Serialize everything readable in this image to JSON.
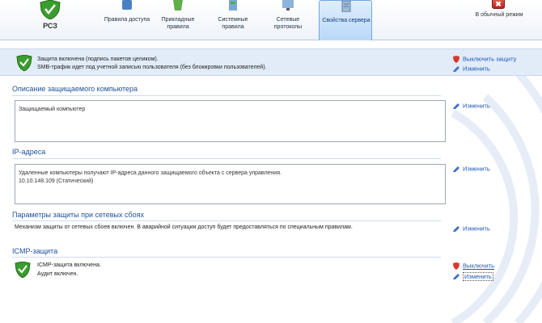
{
  "toolbar": {
    "rsz_label": "РСЗ",
    "tabs": [
      {
        "label": "Правила доступа",
        "icon": "access-rules-icon"
      },
      {
        "label": "Прикладные правила",
        "icon": "application-rules-icon"
      },
      {
        "label": "Системные правила",
        "icon": "system-rules-icon"
      },
      {
        "label": "Сетевые протоколы",
        "icon": "network-protocols-icon"
      },
      {
        "label": "Свойства сервера",
        "icon": "server-properties-icon",
        "active": true
      }
    ],
    "normal_mode_label": "В обычный режим",
    "close_glyph": "✖"
  },
  "status": {
    "line1": "Защита включена (подпись пакетов целиком).",
    "line2": "SMB-трафик идет под учетной записью пользователя (без блокировки пользователей).",
    "disable_link": "Выключить защиту",
    "edit_link": "Изменить"
  },
  "sections": {
    "description": {
      "title": "Описание защищаемого компьютера",
      "text": "Защищаемый компьютер",
      "edit_link": "Изменить"
    },
    "ip": {
      "title": "IP-адреса",
      "line1": "Удаленные компьютеры получают IP-адреса данного защищаемого объекта с сервера управления.",
      "line2": "10.10.148.109 (Статический)",
      "edit_link": "Изменить"
    },
    "failure": {
      "title": "Параметры защиты при сетевых сбоях",
      "text": "Механизм защиты от сетевых сбоев включен. В аварийной ситуации доступ будет предоставляться по специальным правилам.",
      "edit_link": "Изменить"
    },
    "icmp": {
      "title": "ICMP-защита",
      "line1": "ICMP-защита включена.",
      "line2": "Аудит включен.",
      "disable_link": "Выключить",
      "edit_link": "Изменить"
    }
  },
  "colors": {
    "accent": "#1e4f9a",
    "link": "#1b56b8",
    "status_bg": "#e2ecf9",
    "shield_green": "#3a9d2f"
  }
}
